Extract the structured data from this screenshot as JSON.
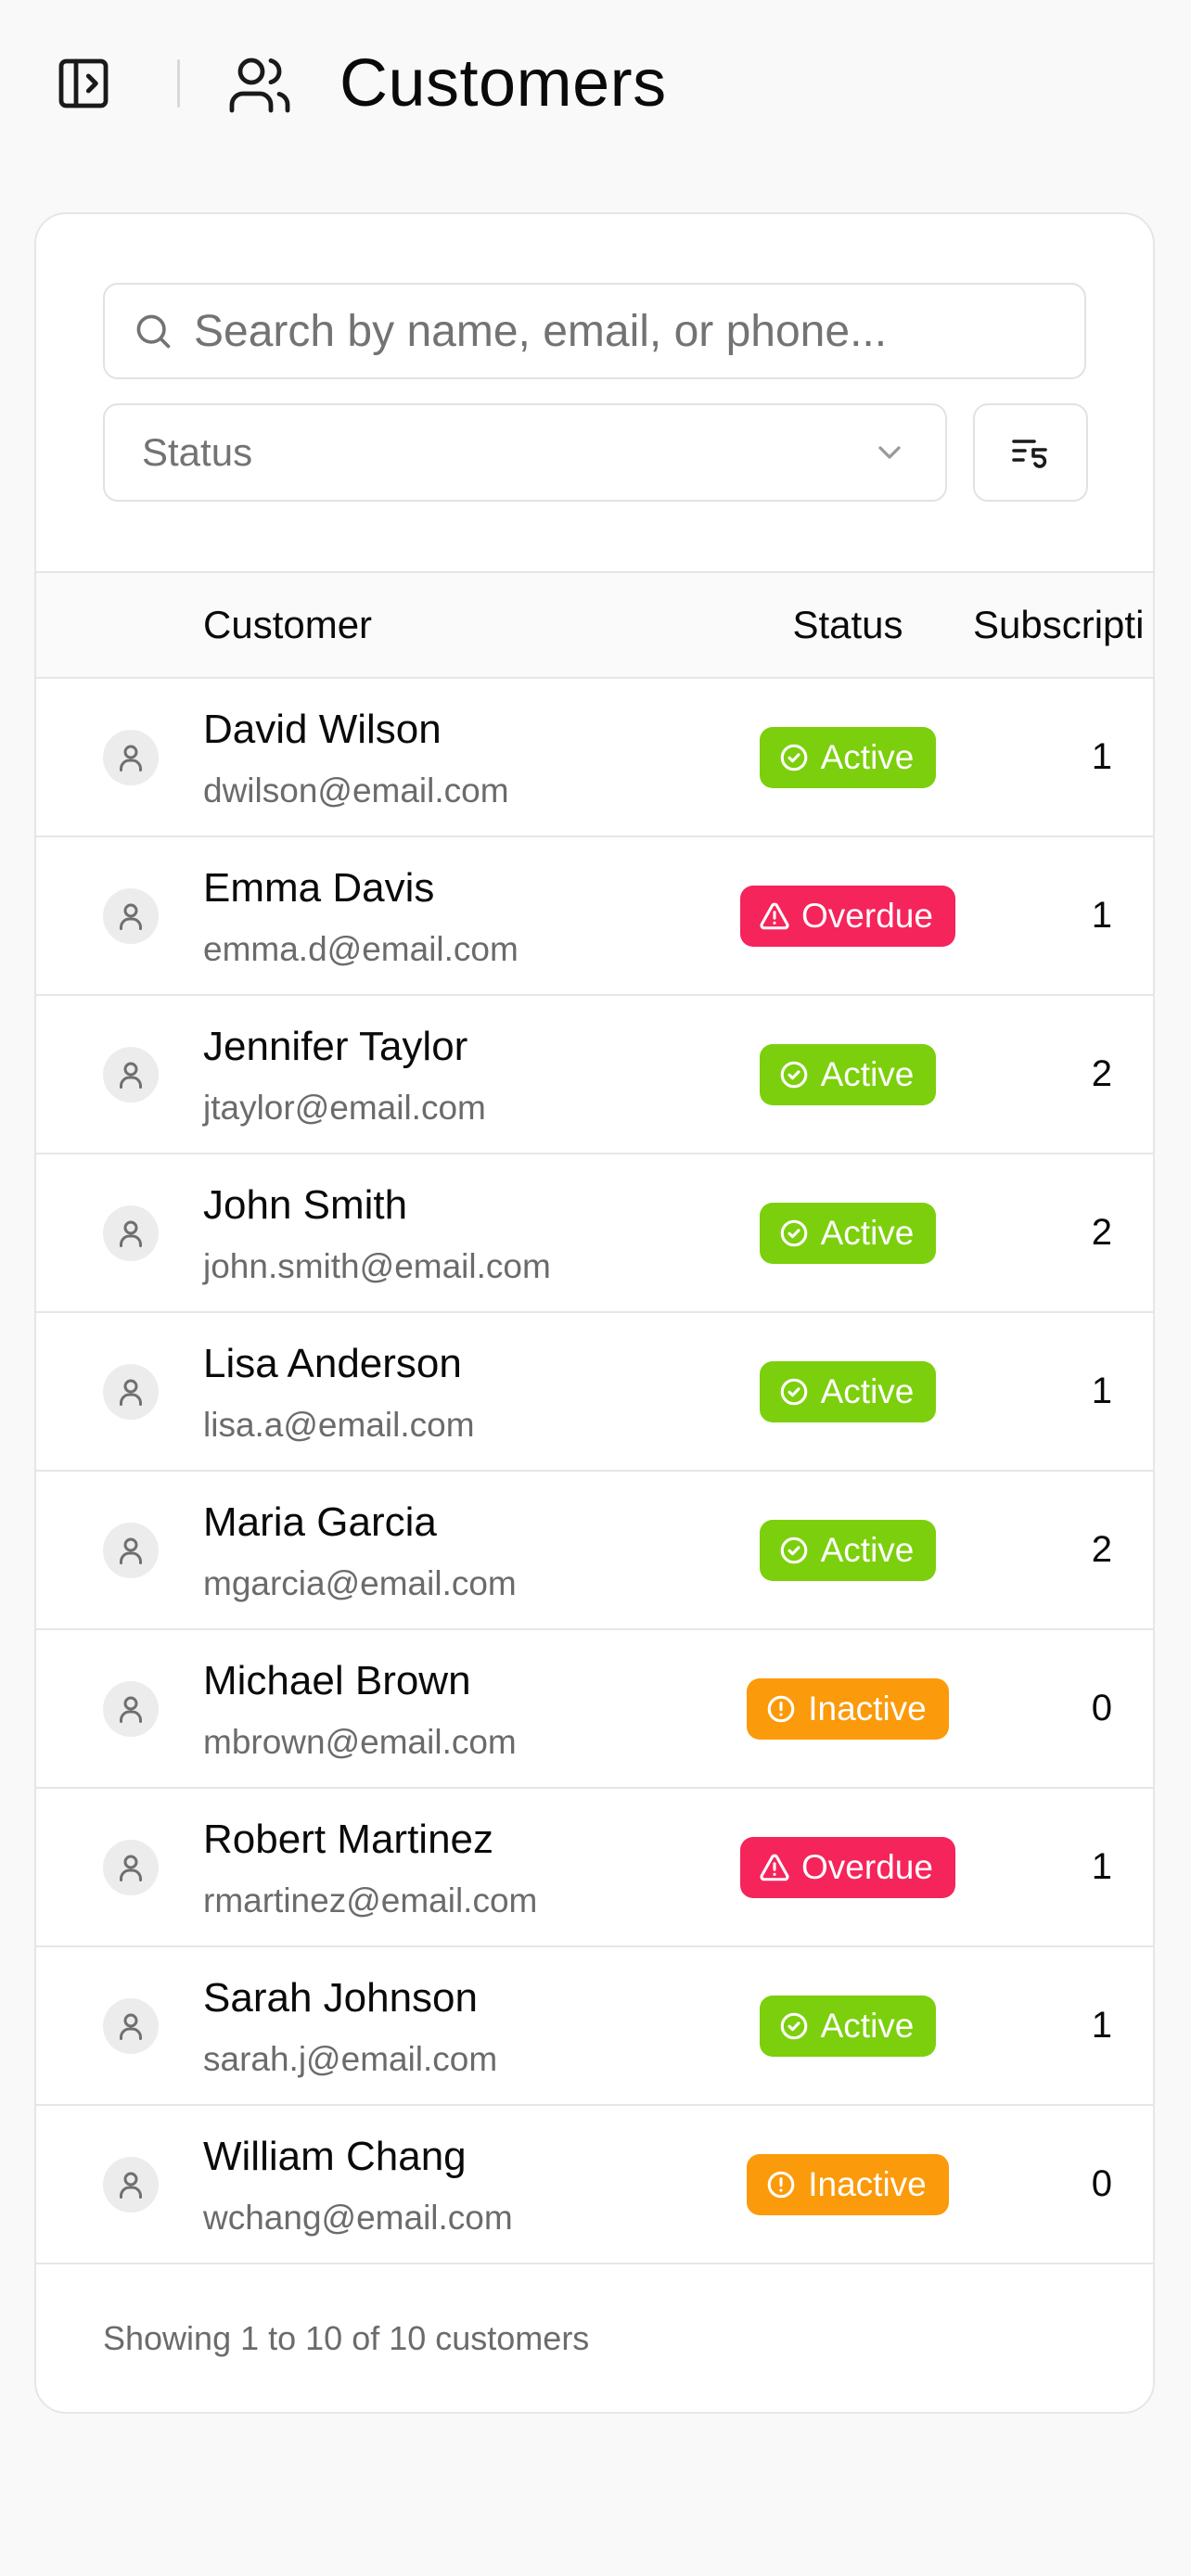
{
  "header": {
    "title": "Customers",
    "sidebar_toggle_icon": "panel-left-open-icon",
    "page_icon": "users-icon"
  },
  "filters": {
    "search_placeholder": "Search by name, email, or phone...",
    "search_value": "",
    "status_placeholder": "Status",
    "reset_icon": "list-filter-reset-icon"
  },
  "table": {
    "columns": [
      "Customer",
      "Status",
      "Subscripti"
    ],
    "rows": [
      {
        "name": "David Wilson",
        "email": "dwilson@email.com",
        "status": "Active",
        "subscriptions": "1"
      },
      {
        "name": "Emma Davis",
        "email": "emma.d@email.com",
        "status": "Overdue",
        "subscriptions": "1"
      },
      {
        "name": "Jennifer Taylor",
        "email": "jtaylor@email.com",
        "status": "Active",
        "subscriptions": "2"
      },
      {
        "name": "John Smith",
        "email": "john.smith@email.com",
        "status": "Active",
        "subscriptions": "2"
      },
      {
        "name": "Lisa Anderson",
        "email": "lisa.a@email.com",
        "status": "Active",
        "subscriptions": "1"
      },
      {
        "name": "Maria Garcia",
        "email": "mgarcia@email.com",
        "status": "Active",
        "subscriptions": "2"
      },
      {
        "name": "Michael Brown",
        "email": "mbrown@email.com",
        "status": "Inactive",
        "subscriptions": "0"
      },
      {
        "name": "Robert Martinez",
        "email": "rmartinez@email.com",
        "status": "Overdue",
        "subscriptions": "1"
      },
      {
        "name": "Sarah Johnson",
        "email": "sarah.j@email.com",
        "status": "Active",
        "subscriptions": "1"
      },
      {
        "name": "William Chang",
        "email": "wchang@email.com",
        "status": "Inactive",
        "subscriptions": "0"
      }
    ]
  },
  "footer": {
    "summary": "Showing 1 to 10 of 10 customers"
  },
  "colors": {
    "active": "#7ccf0c",
    "overdue": "#f5245a",
    "inactive": "#fb9a0a",
    "background": "#f9f9f9"
  }
}
